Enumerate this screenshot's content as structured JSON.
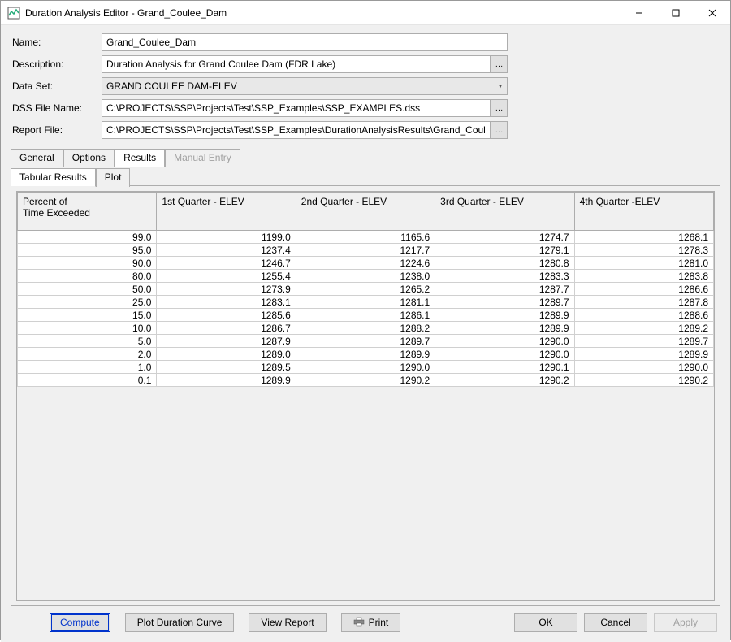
{
  "window": {
    "title": "Duration Analysis Editor - Grand_Coulee_Dam"
  },
  "form": {
    "name_label": "Name:",
    "name_value": "Grand_Coulee_Dam",
    "desc_label": "Description:",
    "desc_value": "Duration Analysis for Grand Coulee Dam (FDR Lake)",
    "dataset_label": "Data Set:",
    "dataset_value": "GRAND COULEE DAM-ELEV",
    "dssfile_label": "DSS File Name:",
    "dssfile_value": "C:\\PROJECTS\\SSP\\Projects\\Test\\SSP_Examples\\SSP_EXAMPLES.dss",
    "report_label": "Report File:",
    "report_value": "C:\\PROJECTS\\SSP\\Projects\\Test\\SSP_Examples\\DurationAnalysisResults\\Grand_Coulee..."
  },
  "tabs": {
    "general": "General",
    "options": "Options",
    "results": "Results",
    "manual": "Manual Entry"
  },
  "subtabs": {
    "tabular": "Tabular Results",
    "plot": "Plot"
  },
  "table": {
    "headers": {
      "percent": "Percent of\nTime Exceeded",
      "q1": "1st Quarter - ELEV",
      "q2": "2nd Quarter - ELEV",
      "q3": "3rd Quarter - ELEV",
      "q4": "4th Quarter -ELEV"
    },
    "rows": [
      {
        "p": "99.0",
        "q1": "1199.0",
        "q2": "1165.6",
        "q3": "1274.7",
        "q4": "1268.1"
      },
      {
        "p": "95.0",
        "q1": "1237.4",
        "q2": "1217.7",
        "q3": "1279.1",
        "q4": "1278.3"
      },
      {
        "p": "90.0",
        "q1": "1246.7",
        "q2": "1224.6",
        "q3": "1280.8",
        "q4": "1281.0"
      },
      {
        "p": "80.0",
        "q1": "1255.4",
        "q2": "1238.0",
        "q3": "1283.3",
        "q4": "1283.8"
      },
      {
        "p": "50.0",
        "q1": "1273.9",
        "q2": "1265.2",
        "q3": "1287.7",
        "q4": "1286.6"
      },
      {
        "p": "25.0",
        "q1": "1283.1",
        "q2": "1281.1",
        "q3": "1289.7",
        "q4": "1287.8"
      },
      {
        "p": "15.0",
        "q1": "1285.6",
        "q2": "1286.1",
        "q3": "1289.9",
        "q4": "1288.6"
      },
      {
        "p": "10.0",
        "q1": "1286.7",
        "q2": "1288.2",
        "q3": "1289.9",
        "q4": "1289.2"
      },
      {
        "p": "5.0",
        "q1": "1287.9",
        "q2": "1289.7",
        "q3": "1290.0",
        "q4": "1289.7"
      },
      {
        "p": "2.0",
        "q1": "1289.0",
        "q2": "1289.9",
        "q3": "1290.0",
        "q4": "1289.9"
      },
      {
        "p": "1.0",
        "q1": "1289.5",
        "q2": "1290.0",
        "q3": "1290.1",
        "q4": "1290.0"
      },
      {
        "p": "0.1",
        "q1": "1289.9",
        "q2": "1290.2",
        "q3": "1290.2",
        "q4": "1290.2"
      }
    ]
  },
  "buttons": {
    "compute": "Compute",
    "plot_curve": "Plot Duration Curve",
    "view_report": "View Report",
    "print": "Print",
    "ok": "OK",
    "cancel": "Cancel",
    "apply": "Apply"
  },
  "icons": {
    "ellipsis": "…"
  }
}
